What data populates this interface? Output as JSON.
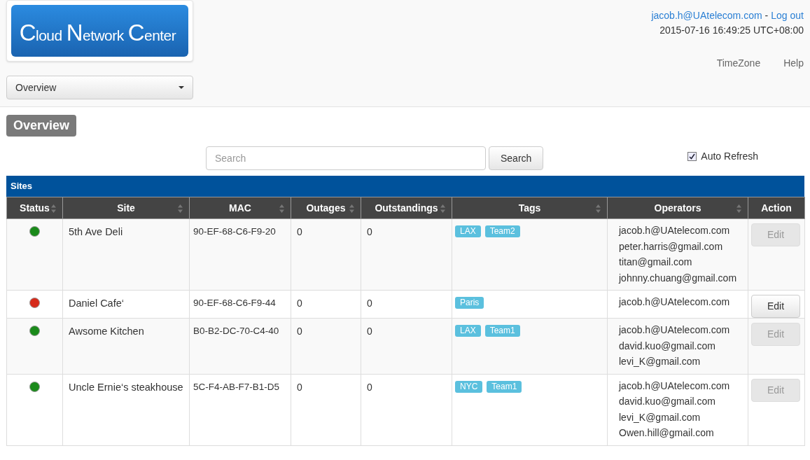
{
  "logo": {
    "text": "Cloud Network Center"
  },
  "header": {
    "user": "jacob.h@UAtelecom.com",
    "separator": "-",
    "logout": "Log out",
    "datetime": "2015-07-16 16:49:25 UTC+08:00",
    "links": [
      "TimeZone",
      "Help"
    ]
  },
  "nav_select": {
    "value": "Overview"
  },
  "page_title": "Overview",
  "search": {
    "placeholder": "Search",
    "button": "Search"
  },
  "auto_refresh": {
    "label": "Auto Refresh",
    "checked": true
  },
  "table": {
    "title": "Sites",
    "columns": [
      {
        "label": "Status",
        "sortable": true
      },
      {
        "label": "Site",
        "sortable": true
      },
      {
        "label": "MAC",
        "sortable": true
      },
      {
        "label": "Outages",
        "sortable": true
      },
      {
        "label": "Outstandings",
        "sortable": true
      },
      {
        "label": "Tags",
        "sortable": true
      },
      {
        "label": "Operators",
        "sortable": true
      },
      {
        "label": "Action",
        "sortable": false
      }
    ],
    "rows": [
      {
        "color": "#1a8a1a",
        "site": "5th Ave Deli",
        "mac": "90-EF-68-C6-F9-20",
        "outages": "0",
        "outstandings": "0",
        "tags": [
          "LAX",
          "Team2"
        ],
        "operators": [
          "jacob.h@UAtelecom.com",
          "peter.harris@gmail.com",
          "titan@gmail.com",
          "johnny.chuang@gmail.com"
        ],
        "action": "Edit",
        "disabled": true
      },
      {
        "color": "#d62a1a",
        "site": "Daniel Cafe‘",
        "mac": "90-EF-68-C6-F9-44",
        "outages": "0",
        "outstandings": "0",
        "tags": [
          "Paris"
        ],
        "operators": [
          "jacob.h@UAtelecom.com"
        ],
        "action": "Edit",
        "disabled": false
      },
      {
        "color": "#1a8a1a",
        "site": "Awsome Kitchen",
        "mac": "B0-B2-DC-70-C4-40",
        "outages": "0",
        "outstandings": "0",
        "tags": [
          "LAX",
          "Team1"
        ],
        "operators": [
          "jacob.h@UAtelecom.com",
          "david.kuo@gmail.com",
          "levi_K@gmail.com"
        ],
        "action": "Edit",
        "disabled": true
      },
      {
        "color": "#1a8a1a",
        "site": "Uncle Ernie‘s steakhouse",
        "mac": "5C-F4-AB-F7-B1-D5",
        "outages": "0",
        "outstandings": "0",
        "tags": [
          "NYC",
          "Team1"
        ],
        "operators": [
          "jacob.h@UAtelecom.com",
          "david.kuo@gmail.com",
          "levi_K@gmail.com",
          "Owen.hill@gmail.com"
        ],
        "action": "Edit",
        "disabled": true
      }
    ]
  }
}
